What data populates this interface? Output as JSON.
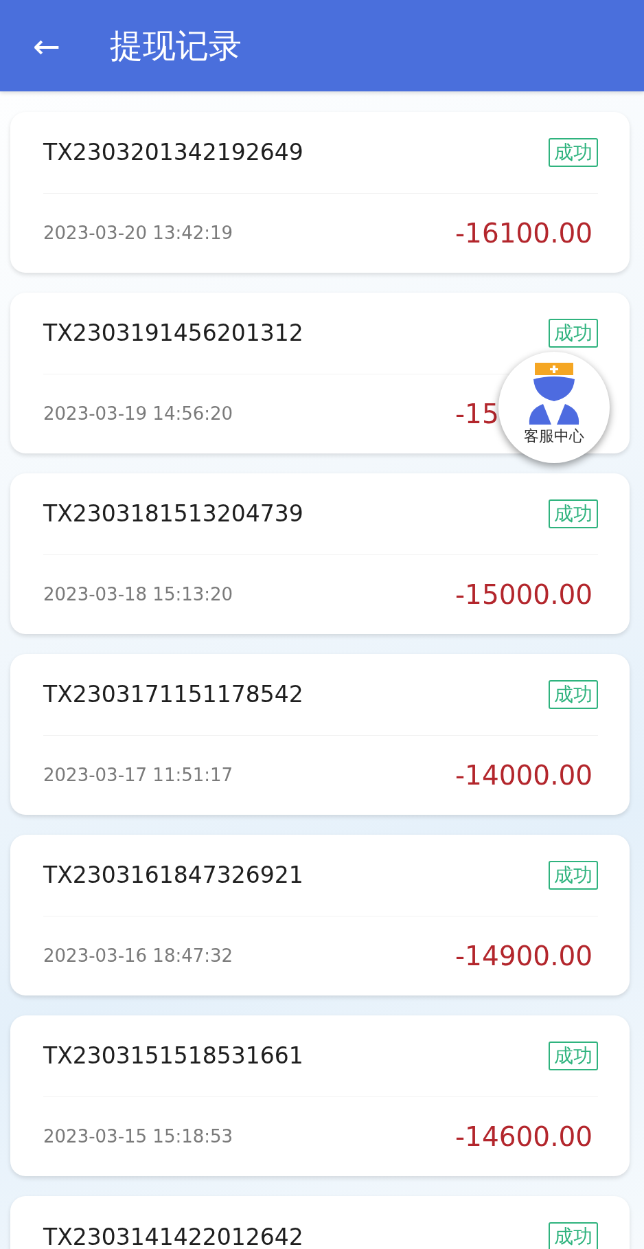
{
  "header": {
    "back": "←",
    "title": "提现记录"
  },
  "records": [
    {
      "order_no": "TX2303201342192649",
      "status": "成功",
      "time": "2023-03-20 13:42:19",
      "amount": "-16100.00"
    },
    {
      "order_no": "TX2303191456201312",
      "status": "成功",
      "time": "2023-03-19 14:56:20",
      "amount": "-15"
    },
    {
      "order_no": "TX2303181513204739",
      "status": "成功",
      "time": "2023-03-18 15:13:20",
      "amount": "-15000.00"
    },
    {
      "order_no": "TX2303171151178542",
      "status": "成功",
      "time": "2023-03-17 11:51:17",
      "amount": "-14000.00"
    },
    {
      "order_no": "TX2303161847326921",
      "status": "成功",
      "time": "2023-03-16 18:47:32",
      "amount": "-14900.00"
    },
    {
      "order_no": "TX2303151518531661",
      "status": "成功",
      "time": "2023-03-15 15:18:53",
      "amount": "-14600.00"
    },
    {
      "order_no": "TX2303141422012642",
      "status": "成功"
    }
  ],
  "floating_button": {
    "label": "客服中心"
  }
}
